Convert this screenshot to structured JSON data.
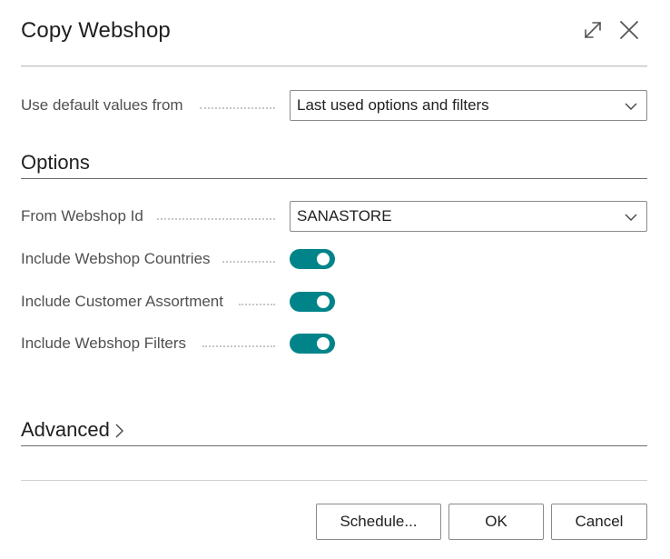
{
  "dialog": {
    "title": "Copy Webshop",
    "icons": {
      "expand": "expand-icon",
      "close": "close-icon"
    }
  },
  "defaults_field": {
    "label": "Use default values from",
    "value": "Last used options and filters"
  },
  "options_section": {
    "title": "Options",
    "from_webshop": {
      "label": "From Webshop Id",
      "value": "SANASTORE"
    },
    "toggles": [
      {
        "label": "Include Webshop Countries",
        "on": true
      },
      {
        "label": "Include Customer Assortment",
        "on": true
      },
      {
        "label": "Include Webshop Filters",
        "on": true
      }
    ]
  },
  "advanced_section": {
    "title": "Advanced"
  },
  "buttons": {
    "schedule": "Schedule...",
    "ok": "OK",
    "cancel": "Cancel"
  },
  "colors": {
    "toggle_on": "#008489",
    "text": "#212121",
    "label": "#505050"
  }
}
